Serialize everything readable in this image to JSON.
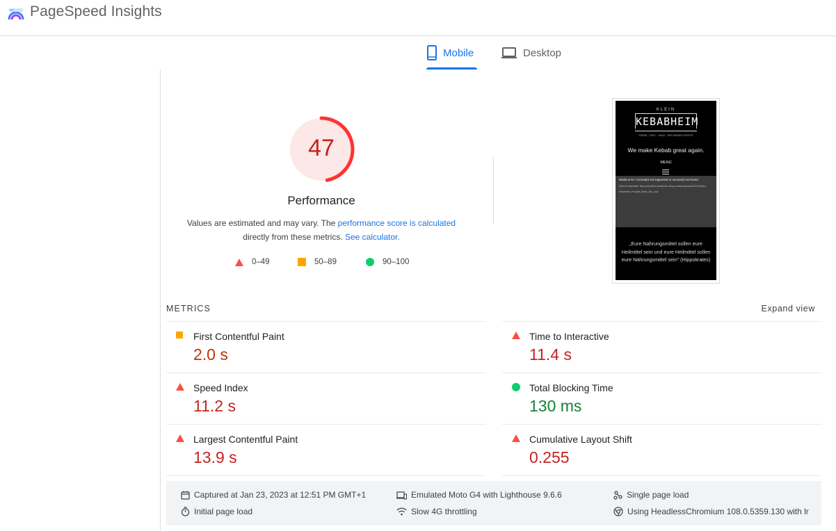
{
  "header": {
    "title": "PageSpeed Insights",
    "logo_icon": "pagespeed-logo"
  },
  "tabs": [
    {
      "label": "Mobile",
      "icon": "phone-icon",
      "active": true
    },
    {
      "label": "Desktop",
      "icon": "laptop-icon",
      "active": false
    }
  ],
  "score": {
    "value": "47",
    "fraction": 0.47,
    "label": "Performance",
    "desc_part1": "Values are estimated and may vary. The ",
    "desc_link1": "performance score is calculated",
    "desc_part2": "directly from these metrics. ",
    "desc_link2": "See calculator."
  },
  "legend": [
    {
      "range": "0–49",
      "shape": "triangle",
      "color": "#ff4e42"
    },
    {
      "range": "50–89",
      "shape": "square",
      "color": "#ffa400"
    },
    {
      "range": "90–100",
      "shape": "circle",
      "color": "#0cce6b"
    }
  ],
  "screenshot": {
    "brand_top": "KLEIN",
    "brand": "KEBABHEIM",
    "brand_sub": "KEBAB · GRILL · HAUS · DER KEBAB EXPERTE",
    "tagline": "We make Kebab great again.",
    "menu": "MENÜ",
    "media_error": "Media error: Format(s) not supported or source(s) not found",
    "media_line1": "Datei herunterladen: https://www.klein-kebabheim.de/wp-content/uploads/2022/10/Video-",
    "media_line2": "Kebabheim_Produkte_Bilder_Alle_.mp4",
    "quote": "„Eure Nahrungsmittel sollen eure Heilmittel sein und eure Heilmittel sollen eure Nahrungsmittel sein\" (Hippokrates)"
  },
  "metrics": {
    "title": "METRICS",
    "expand": "Expand view",
    "items": [
      {
        "name": "First Contentful Paint",
        "value": "2.0 s",
        "rating": "average"
      },
      {
        "name": "Time to Interactive",
        "value": "11.4 s",
        "rating": "fail"
      },
      {
        "name": "Speed Index",
        "value": "11.2 s",
        "rating": "fail"
      },
      {
        "name": "Total Blocking Time",
        "value": "130 ms",
        "rating": "pass"
      },
      {
        "name": "Largest Contentful Paint",
        "value": "13.9 s",
        "rating": "fail"
      },
      {
        "name": "Cumulative Layout Shift",
        "value": "0.255",
        "rating": "fail"
      }
    ]
  },
  "environment": {
    "captured": "Captured at Jan 23, 2023 at 12:51 PM GMT+1",
    "device": "Emulated Moto G4 with Lighthouse 9.6.6",
    "load": "Single page load",
    "initial": "Initial page load",
    "throttling": "Slow 4G throttling",
    "browser": "Using HeadlessChromium 108.0.5359.130 with lr"
  }
}
